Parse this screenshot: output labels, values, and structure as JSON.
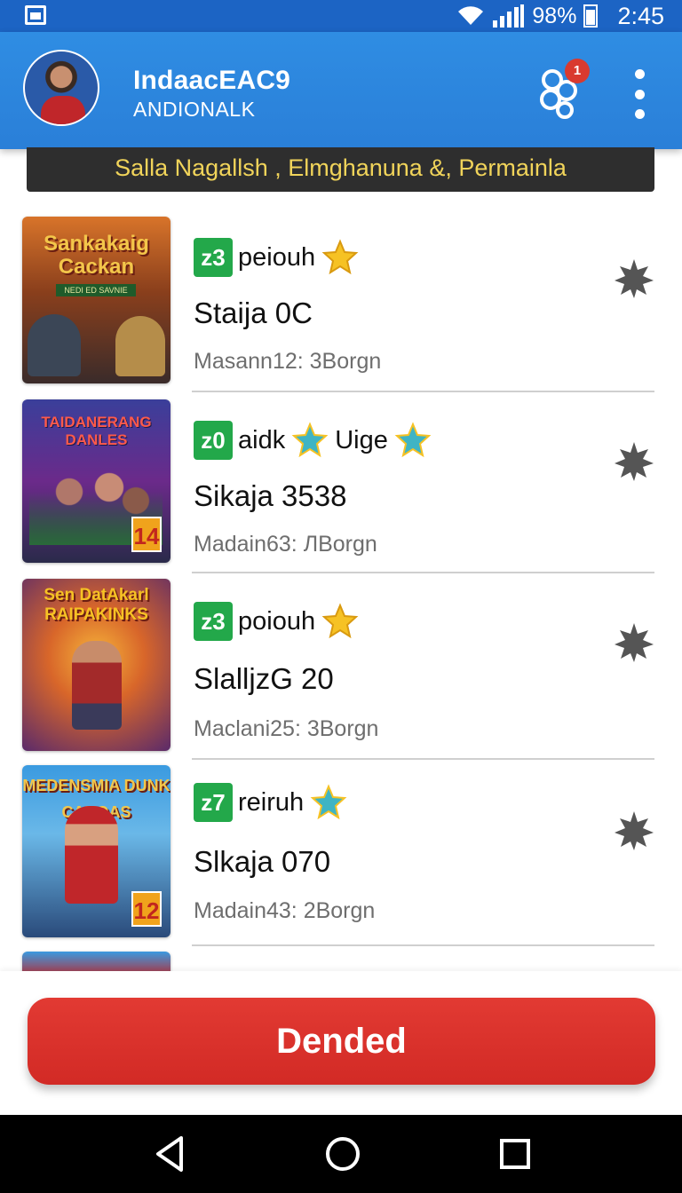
{
  "status_bar": {
    "battery": "98%",
    "time": "2:45",
    "icons": [
      "screenshot-icon",
      "wifi-icon",
      "signal-icon",
      "battery-icon"
    ]
  },
  "app_bar": {
    "title": "IndaacEAC9",
    "subtitle": "ANDIONALK",
    "notification_count": "1"
  },
  "banner": {
    "text": "Salla Nagallsh , Elmghanuna  &, Permainla"
  },
  "items": [
    {
      "thumb_title": "Sankakaig Cackan",
      "thumb_sub": "NEDI ED SAVNIE",
      "code": "z3",
      "tag": "peiouh",
      "title": "Staija 0C",
      "meta": "Masann12: 3Borgn"
    },
    {
      "thumb_title": "TAIDANERANG DANLES",
      "thumb_badge": "14",
      "code": "z0",
      "tag": "aidk",
      "tag2": "Uige",
      "title": "Sikaja 3538",
      "meta": "Madain63: ЛBorgn"
    },
    {
      "thumb_title": "Sen DatAkarl RAIPAKINKS",
      "code": "z3",
      "tag": "poiouh",
      "title": "SlalljzG 20",
      "meta": "Maclani25: 3Borgn"
    },
    {
      "thumb_title": "MEDENSMIA DUNK CAKOAS",
      "thumb_badge": "12",
      "code": "z7",
      "tag": "reiruh",
      "title": "Slkaja 070",
      "meta": "Madain43: 2Borgn"
    }
  ],
  "cta": {
    "label": "Dended"
  },
  "colors": {
    "app_bar": "#2a7fd8",
    "banner_bg": "#2e2e2e",
    "banner_text": "#f1d45a",
    "code_badge": "#23a84a",
    "cta": "#d93a2f"
  }
}
